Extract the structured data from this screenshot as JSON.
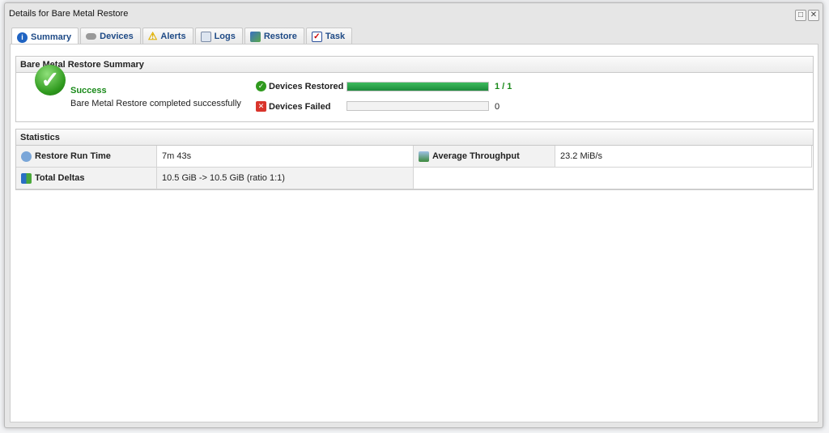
{
  "dialog": {
    "title": "Details for Bare Metal Restore"
  },
  "tabs": [
    {
      "label": "Summary",
      "icon": "info-icon"
    },
    {
      "label": "Devices",
      "icon": "disk-icon"
    },
    {
      "label": "Alerts",
      "icon": "warning-icon"
    },
    {
      "label": "Logs",
      "icon": "log-icon"
    },
    {
      "label": "Restore",
      "icon": "restore-icon"
    },
    {
      "label": "Task",
      "icon": "task-icon"
    }
  ],
  "summary": {
    "header": "Bare Metal Restore Summary",
    "status": "Success",
    "message": "Bare Metal Restore completed successfully",
    "restored_label": "Devices Restored",
    "restored_value": "1 / 1",
    "restored_fraction": 1,
    "failed_label": "Devices Failed",
    "failed_value": "0",
    "failed_fraction": 0
  },
  "statistics": {
    "header": "Statistics",
    "run_time_label": "Restore Run Time",
    "run_time": "7m 43s",
    "throughput_label": "Average Throughput",
    "throughput": "23.2 MiB/s",
    "deltas_label": "Total Deltas",
    "deltas": "10.5 GiB -> 10.5 GiB (ratio 1:1)"
  },
  "colors": {
    "success": "#1a8a1a",
    "tab_text": "#1e4a86",
    "progress": "#1c8a3a"
  }
}
